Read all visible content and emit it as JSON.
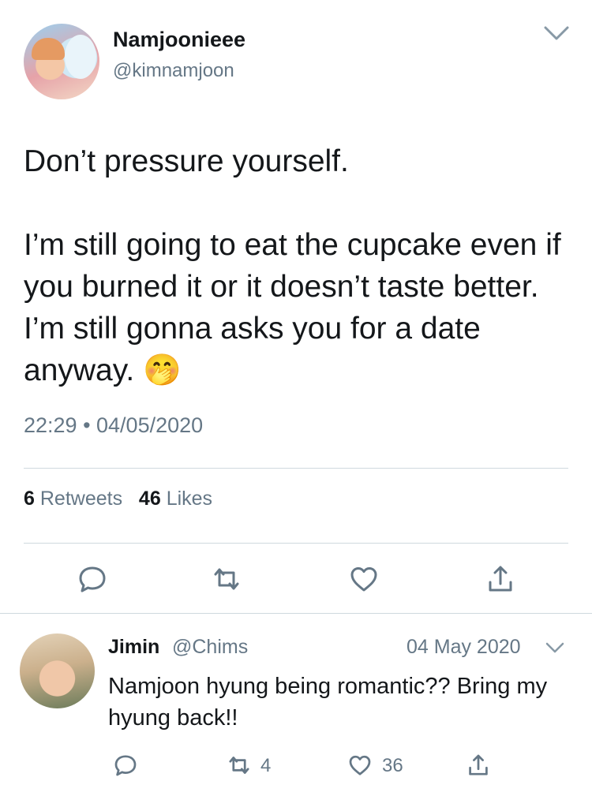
{
  "tweet": {
    "author_name": "Namjoonieee",
    "author_handle": "@kimnamjoon",
    "text": "Don’t pressure yourself.\n\nI’m still going to eat the cupcake even if you burned it or it doesn’t taste better. I’m still gonna asks you for a date anyway.",
    "emoji": "🤭",
    "timestamp": "22:29 • 04/05/2020",
    "retweets_count": "6",
    "retweets_label": "Retweets",
    "likes_count": "46",
    "likes_label": "Likes"
  },
  "reply": {
    "author_name": "Jimin",
    "author_handle": "@Chims",
    "date": "04 May 2020",
    "text": "Namjoon hyung being romantic?? Bring my hyung back!!",
    "retweet_count": "4",
    "like_count": "36"
  },
  "icons": {
    "reply": "reply-icon",
    "retweet": "retweet-icon",
    "like": "heart-icon",
    "share": "share-icon",
    "menu": "chevron-down-icon"
  },
  "colors": {
    "primary_text": "#14171a",
    "secondary_text": "#657786",
    "divider": "#cfd9de"
  }
}
